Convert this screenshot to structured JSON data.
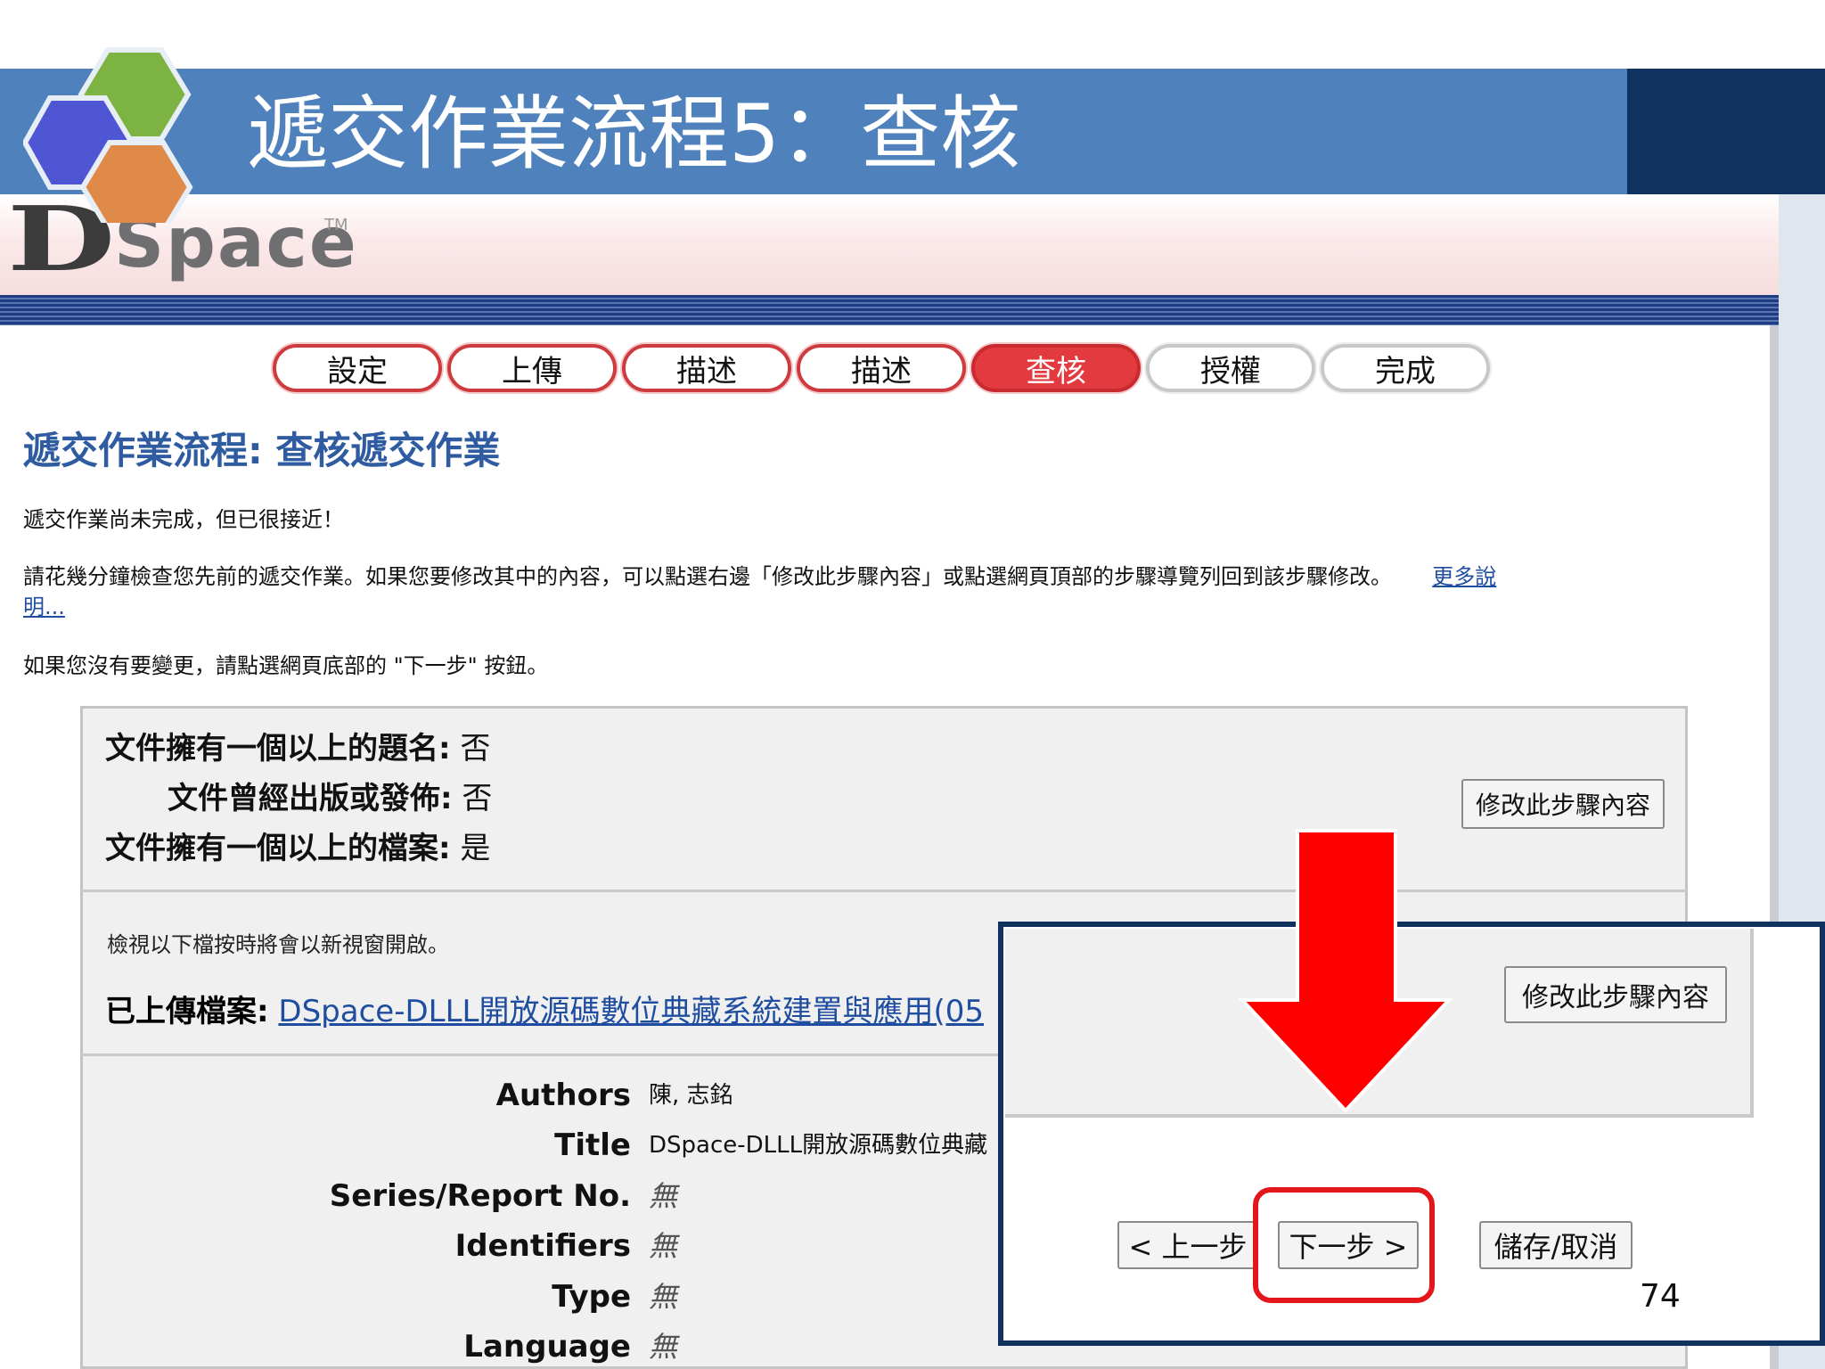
{
  "slide": {
    "title": "遞交作業流程5：查核",
    "page_number": "74"
  },
  "colors": {
    "banner": "#4f81bd",
    "banner_dark": "#10325e",
    "step_active": "#e23a3f",
    "heading": "#2f5ca0",
    "highlight": "#e3161c"
  },
  "header": {
    "logo_d": "D",
    "logo_space": "Space",
    "logo_tm": "TM"
  },
  "steps": [
    {
      "label": "設定",
      "state": "done"
    },
    {
      "label": "上傳",
      "state": "done"
    },
    {
      "label": "描述",
      "state": "done"
    },
    {
      "label": "描述",
      "state": "done"
    },
    {
      "label": "查核",
      "state": "active"
    },
    {
      "label": "授權",
      "state": "future"
    },
    {
      "label": "完成",
      "state": "future"
    }
  ],
  "page": {
    "heading": "遞交作業流程: 查核遞交作業",
    "line1": "遞交作業尚未完成，但已很接近！",
    "line2": "請花幾分鐘檢查您先前的遞交作業。如果您要修改其中的內容，可以點選右邊「修改此步驟內容」或點選網頁頂部的步驟導覽列回到該步驟修改。",
    "help_link_1": "更多說",
    "help_link_2": "明...",
    "line3": "如果您沒有要變更，請點選網頁底部的 \"下一步\" 按鈕。"
  },
  "questions": [
    {
      "label": "文件擁有一個以上的題名:",
      "value": "否"
    },
    {
      "label": "文件曾經出版或發佈:",
      "value": "否"
    },
    {
      "label": "文件擁有一個以上的檔案:",
      "value": "是"
    }
  ],
  "edit_button_label": "修改此步驟內容",
  "file_section": {
    "note": "檢視以下檔按時將會以新視窗開啟。",
    "label": "已上傳檔案:",
    "file_link": "DSpace-DLLL開放源碼數位典藏系統建置與應用(05"
  },
  "metadata": [
    {
      "label": "Authors",
      "value": "陳, 志銘",
      "none": false
    },
    {
      "label": "Title",
      "value": "DSpace-DLLL開放源碼數位典藏",
      "none": false
    },
    {
      "label": "Series/Report No.",
      "value": "無",
      "none": true
    },
    {
      "label": "Identifiers",
      "value": "無",
      "none": true
    },
    {
      "label": "Type",
      "value": "無",
      "none": true
    },
    {
      "label": "Language",
      "value": "無",
      "none": true
    }
  ],
  "nav": {
    "prev": "< 上一步",
    "next": "下一步 >",
    "save": "儲存/取消"
  }
}
